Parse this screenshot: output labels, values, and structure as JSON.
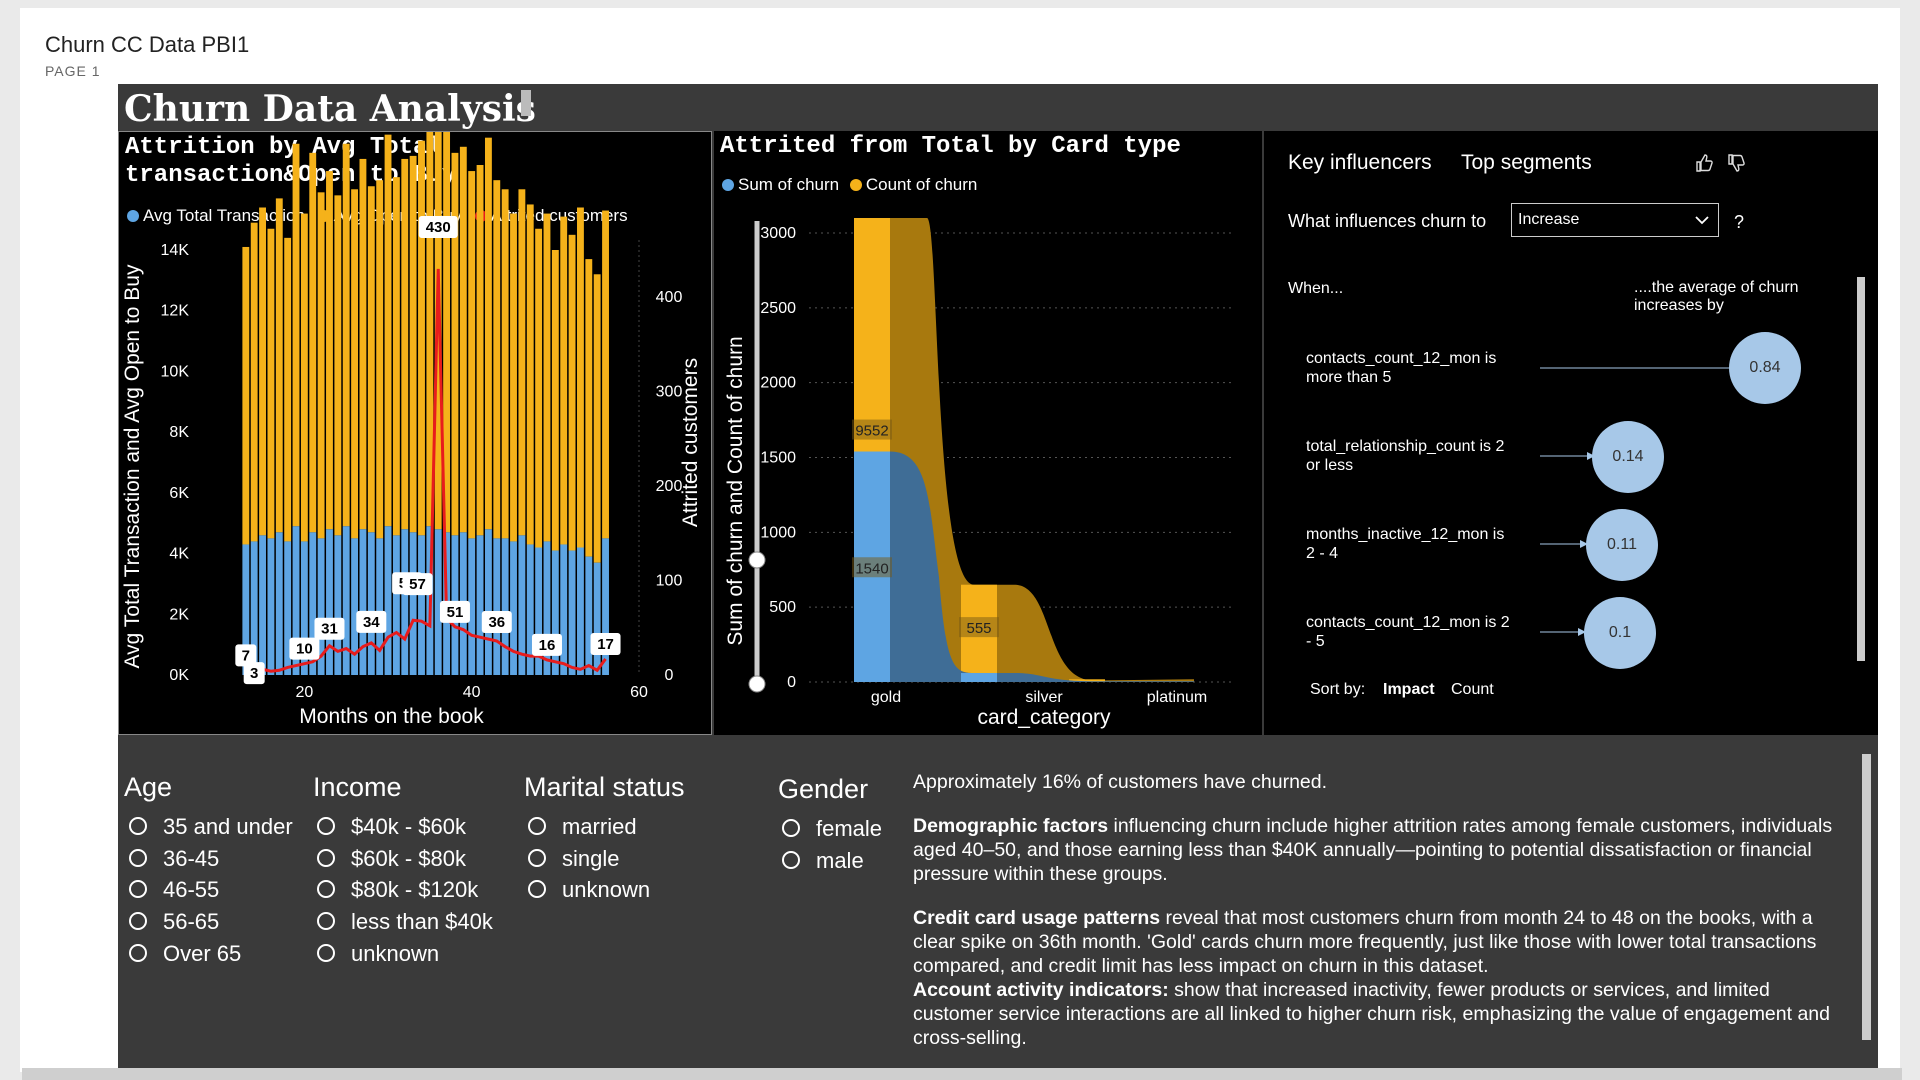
{
  "header": {
    "report_title": "Churn CC Data PBI1",
    "page_label": "PAGE 1"
  },
  "dashboard_title": "Churn Data Analysis",
  "chart1": {
    "title_line1": "Attrition by Avg Total",
    "title_line2": "transaction&Open to Buy",
    "legend": [
      "Avg Total Transaction",
      "Avg Open to Buy",
      "Attrited customers"
    ],
    "y_left_label": "Avg Total Transaction and Avg Open to Buy",
    "y_right_label": "Attrited customers",
    "x_label": "Months on the book",
    "y_left_ticks": [
      "0K",
      "2K",
      "4K",
      "6K",
      "8K",
      "10K",
      "12K",
      "14K"
    ],
    "y_right_ticks": [
      "0",
      "100",
      "200",
      "300",
      "400"
    ],
    "x_ticks": [
      "20",
      "40",
      "60"
    ]
  },
  "chart2": {
    "title": "Attrited from Total by Card type",
    "legend": [
      "Sum of churn",
      "Count of churn"
    ],
    "y_label": "Sum of churn and Count of churn",
    "x_label": "card_category",
    "y_ticks": [
      "0",
      "500",
      "1000",
      "1500",
      "2000",
      "2500",
      "3000"
    ],
    "labels": {
      "gold_count": "9552",
      "gold_sum": "1540",
      "silver": "555"
    }
  },
  "key_influencers": {
    "tab_active": "Key influencers",
    "tab_other": "Top segments",
    "question": "What influences churn to",
    "dropdown_value": "Increase",
    "help": "?",
    "when_label": "When...",
    "increase_label": "....the average of churn increases by",
    "items": [
      {
        "text": "contacts_count_12_mon is more than 5",
        "value": "0.84"
      },
      {
        "text": "total_relationship_count is 2 or less",
        "value": "0.14"
      },
      {
        "text": "months_inactive_12_mon is 2 - 4",
        "value": "0.11"
      },
      {
        "text": "contacts_count_12_mon is 2 - 5",
        "value": "0.1"
      }
    ],
    "sort_by": "Sort by:",
    "sort_impact": "Impact",
    "sort_count": "Count"
  },
  "slicers": {
    "age": {
      "title": "Age",
      "options": [
        "35 and under",
        "36-45",
        "46-55",
        "56-65",
        "Over 65"
      ]
    },
    "income": {
      "title": "Income",
      "options": [
        "$40k - $60k",
        "$60k - $80k",
        "$80k - $120k",
        "less than $40k",
        "unknown"
      ]
    },
    "marital": {
      "title": "Marital status",
      "options": [
        "married",
        "single",
        "unknown"
      ]
    },
    "gender": {
      "title": "Gender",
      "options": [
        "female",
        "male"
      ]
    }
  },
  "narrative": {
    "p1": "Approximately 16% of customers have churned.",
    "p2_bold": "Demographic factors",
    "p2_text": " influencing churn include higher attrition rates among female customers, individuals aged 40–50, and those earning less than $40K annually—pointing to potential dissatisfaction or financial pressure within these groups.",
    "p3_bold": "Credit card usage patterns",
    "p3_text": " reveal that most customers churn from month 24 to 48 on the books, with a clear spike on 36th month. 'Gold' cards churn more frequently, just like those with lower total transactions compared, and credit limit has less impact on churn in this dataset.",
    "p4_bold": "Account activity indicators:",
    "p4_text": "  show that increased inactivity, fewer products or services, and limited customer service interactions are all linked to higher churn risk, emphasizing the value of engagement and cross-selling."
  },
  "colors": {
    "blue": "#5ea5e3",
    "orange": "#f5b21a",
    "red": "#e81c1c",
    "panel": "#000000",
    "background": "#3a3a3a"
  },
  "chart_data": [
    {
      "type": "bar",
      "title": "Attrition by Avg Total transaction&Open to Buy",
      "xlabel": "Months on the book",
      "ylabel": "Avg Total Transaction and Avg Open to Buy",
      "y2label": "Attrited customers",
      "ylim": [
        0,
        14000
      ],
      "y2lim": [
        0,
        450
      ],
      "x": [
        13,
        14,
        15,
        16,
        17,
        18,
        19,
        20,
        21,
        22,
        23,
        24,
        25,
        26,
        27,
        28,
        29,
        30,
        31,
        32,
        33,
        34,
        35,
        36,
        37,
        38,
        39,
        40,
        41,
        42,
        43,
        44,
        45,
        46,
        47,
        48,
        49,
        50,
        51,
        52,
        53,
        54,
        55,
        56
      ],
      "series": [
        {
          "name": "Avg Total Transaction",
          "values": [
            4300,
            4400,
            4600,
            4500,
            4700,
            4400,
            4900,
            4400,
            4700,
            4500,
            4800,
            4600,
            4900,
            4500,
            4800,
            4700,
            4500,
            4900,
            4600,
            4800,
            4700,
            4600,
            4900,
            4800,
            4700,
            4600,
            4700,
            4500,
            4600,
            4800,
            4500,
            4500,
            4400,
            4600,
            4300,
            4200,
            4400,
            4100,
            4300,
            4100,
            4200,
            3900,
            3700,
            4500
          ]
        },
        {
          "name": "Avg Open to Buy",
          "values": [
            9800,
            10500,
            10800,
            10200,
            11000,
            10000,
            12600,
            10800,
            12500,
            11400,
            11800,
            11200,
            12600,
            11500,
            12200,
            11400,
            11800,
            12900,
            11800,
            12200,
            12400,
            13000,
            13600,
            13400,
            13200,
            12600,
            12700,
            12100,
            12200,
            12900,
            11800,
            11500,
            10800,
            11400,
            11200,
            10500,
            10800,
            9900,
            10800,
            10400,
            11200,
            9800,
            9500,
            10800
          ]
        },
        {
          "name": "Attrited customers",
          "values": [
            7,
            3,
            6,
            4,
            5,
            8,
            10,
            12,
            14,
            20,
            31,
            25,
            28,
            22,
            30,
            34,
            26,
            40,
            45,
            38,
            58,
            57,
            52,
            430,
            60,
            51,
            48,
            42,
            40,
            38,
            36,
            30,
            25,
            22,
            20,
            20,
            16,
            14,
            12,
            8,
            6,
            10,
            5,
            17
          ]
        }
      ],
      "data_labels": [
        7,
        3,
        10,
        31,
        58,
        34,
        57,
        430,
        51,
        36,
        16,
        17
      ],
      "legend": "top"
    },
    {
      "type": "area",
      "title": "Attrited from Total by Card type",
      "xlabel": "card_category",
      "ylabel": "Sum of churn and Count of churn",
      "categories": [
        "gold",
        "silver",
        "platinum"
      ],
      "ylim": [
        0,
        3000
      ],
      "series": [
        {
          "name": "Sum of churn",
          "values": [
            1540,
            60,
            10
          ]
        },
        {
          "name": "Count of churn",
          "values": [
            9552,
            555,
            20
          ]
        }
      ],
      "data_labels": [
        "9552",
        "1540",
        "555"
      ],
      "legend": "top"
    }
  ]
}
